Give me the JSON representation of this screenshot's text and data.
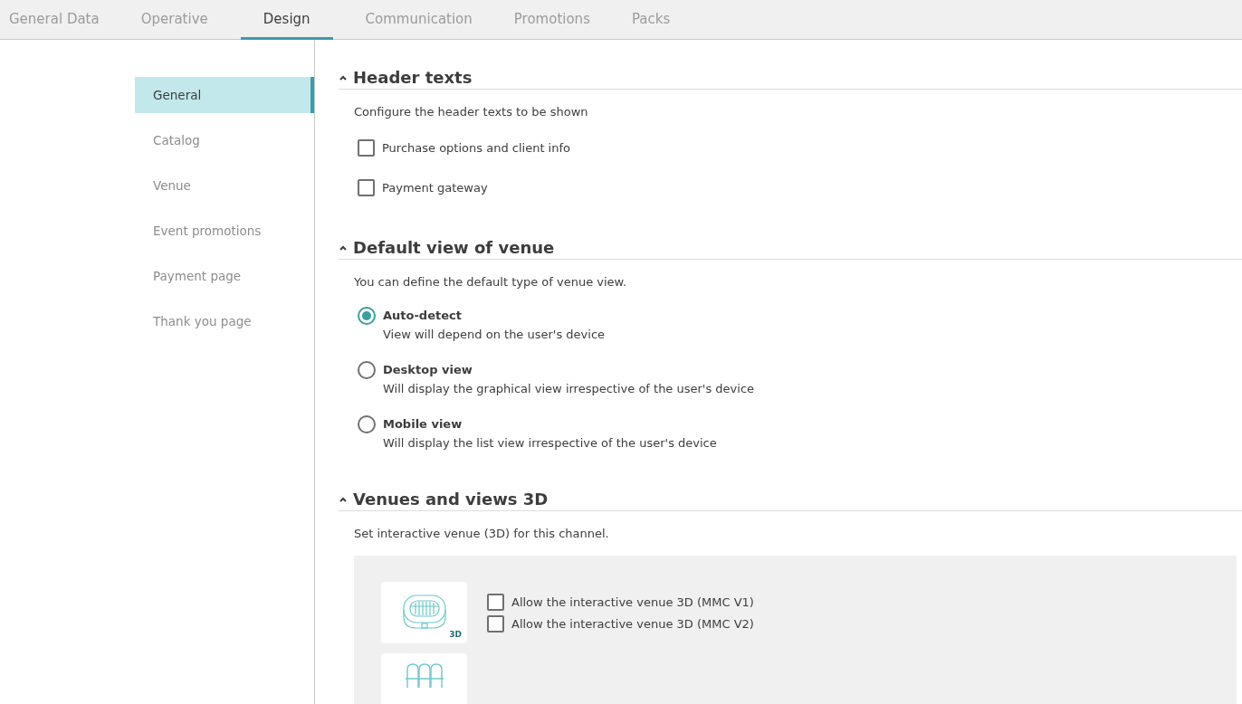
{
  "tabs": [
    {
      "label": "General Data",
      "selected": false
    },
    {
      "label": "Operative",
      "selected": false
    },
    {
      "label": "Design",
      "selected": true
    },
    {
      "label": "Communication",
      "selected": false
    },
    {
      "label": "Promotions",
      "selected": false
    },
    {
      "label": "Packs",
      "selected": false
    }
  ],
  "sidebar": {
    "items": [
      {
        "label": "General",
        "selected": true
      },
      {
        "label": "Catalog",
        "selected": false
      },
      {
        "label": "Venue",
        "selected": false
      },
      {
        "label": "Event promotions",
        "selected": false
      },
      {
        "label": "Payment page",
        "selected": false
      },
      {
        "label": "Thank you page",
        "selected": false
      }
    ]
  },
  "sections": [
    {
      "title": "Header texts",
      "expanded": true,
      "description": "Configure the header texts to be shown",
      "options": [
        {
          "kind": "checkbox",
          "label": "Purchase options and client info",
          "checked": false
        },
        {
          "kind": "checkbox",
          "label": "Payment gateway",
          "checked": false
        }
      ]
    },
    {
      "title": "Default view of venue",
      "expanded": true,
      "description": "You can define the default type of venue view.",
      "options": [
        {
          "kind": "radio",
          "label": "Auto-detect",
          "hint": "View will depend on the user's device",
          "selected": true
        },
        {
          "kind": "radio",
          "label": "Desktop view",
          "hint": "Will display the graphical view irrespective of the user's device",
          "selected": false
        },
        {
          "kind": "radio",
          "label": "Mobile view",
          "hint": "Will display the list view irrespective of the user's device",
          "selected": false
        }
      ]
    },
    {
      "title": "Venues and views 3D",
      "expanded": true,
      "description": "Set interactive venue (3D) for this channel.",
      "panel": {
        "cards": [
          {
            "kind": "stadium",
            "badge": "3D",
            "options": [
              {
                "label": "Allow the interactive venue 3D (MMC V1)",
                "checked": false
              },
              {
                "label": "Allow the interactive venue 3D (MMC V2)",
                "checked": false
              }
            ]
          },
          {
            "kind": "seats"
          }
        ]
      }
    }
  ]
}
